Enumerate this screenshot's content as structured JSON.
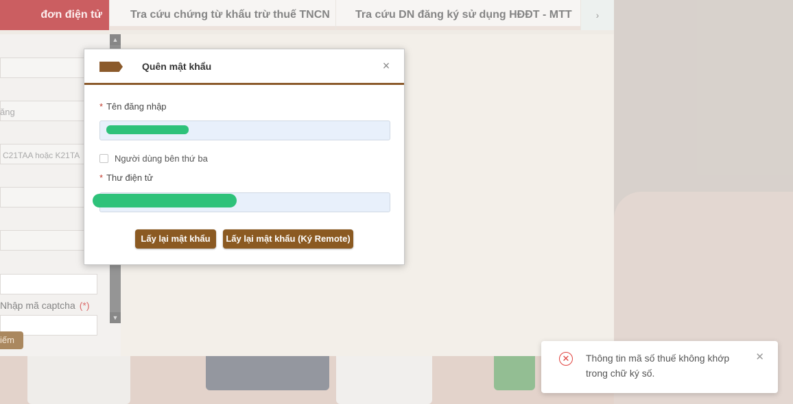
{
  "nav": {
    "tabs": [
      {
        "label": "đơn điện tử"
      },
      {
        "label": "Tra cứu chứng từ khấu trừ thuế TNCN"
      },
      {
        "label": "Tra cứu DN đăng ký sử dụng HĐĐT - MTT"
      }
    ],
    "next_glyph": "›"
  },
  "left_form": {
    "fragment_1": "ăng",
    "fragment_2": "C21TAA hoặc K21TA",
    "captcha_label": "Nhập mã captcha",
    "captcha_required": "(*)",
    "search_button": "iếm"
  },
  "modal": {
    "title": "Quên mật khẩu",
    "close_glyph": "×",
    "username_label": "Tên đăng nhập",
    "username_value": "",
    "third_party_label": "Người dùng bên thứ ba",
    "email_label": "Thư điện tử",
    "email_value": "",
    "required_mark": "*",
    "button_primary": "Lấy lại mật khẩu",
    "button_remote": "Lấy lại mật khẩu (Ký Remote)"
  },
  "toast": {
    "message": "Thông tin mã số thuế không khớp trong chữ ký số.",
    "icon_glyph": "✕",
    "close_glyph": "✕",
    "accent_color": "#e0403c"
  },
  "colors": {
    "brand_red": "#b82025",
    "brand_brown": "#8b5a22"
  }
}
